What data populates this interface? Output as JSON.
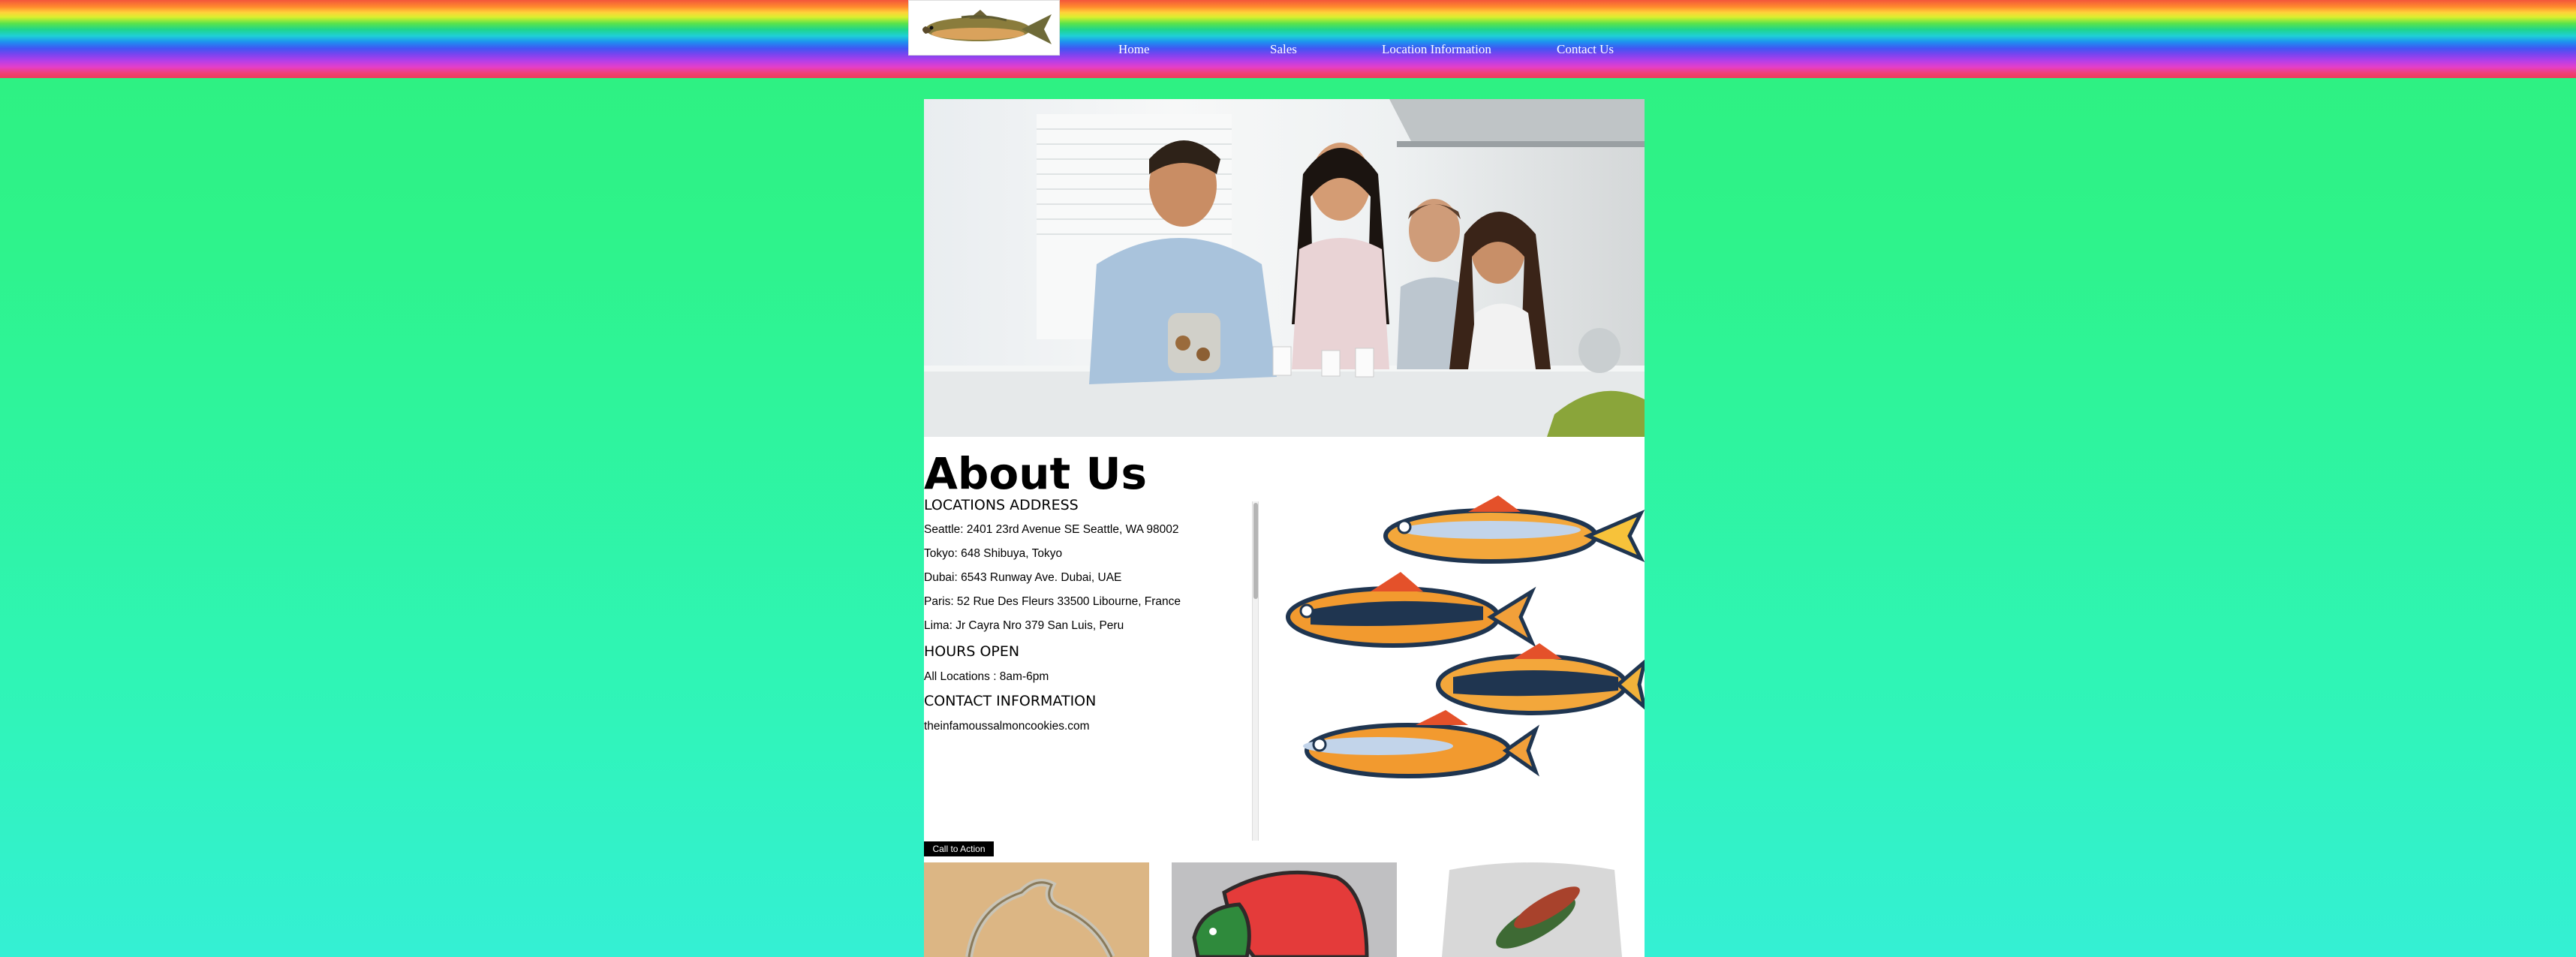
{
  "nav": {
    "items": [
      {
        "label": "Home"
      },
      {
        "label": "Sales"
      },
      {
        "label": "Location Information"
      },
      {
        "label": "Contact Us"
      }
    ]
  },
  "about": {
    "title": "About Us",
    "locations_heading": "LOCATIONS ADDRESS",
    "locations": [
      "Seattle: 2401 23rd Avenue SE Seattle, WA 98002",
      "Tokyo: 648 Shibuya, Tokyo",
      "Dubai: 6543 Runway Ave. Dubai, UAE",
      "Paris: 52 Rue Des Fleurs 33500 Libourne, France",
      "Lima: Jr Cayra Nro 379 San Luis, Peru"
    ],
    "hours_heading": "HOURS OPEN",
    "hours": "All Locations : 8am-6pm",
    "contact_heading": "CONTACT INFORMATION",
    "contact": "theinfamoussalmoncookies.com",
    "cta_label": "Call to Action"
  },
  "colors": {
    "page_bg": "#2ef38a",
    "content_bg": "#ffffff",
    "cta_bg": "#000000",
    "nav_text": "#ffffff"
  },
  "icons": {
    "logo": "salmon-logo-icon",
    "fish": "fish-illustration-icon"
  }
}
